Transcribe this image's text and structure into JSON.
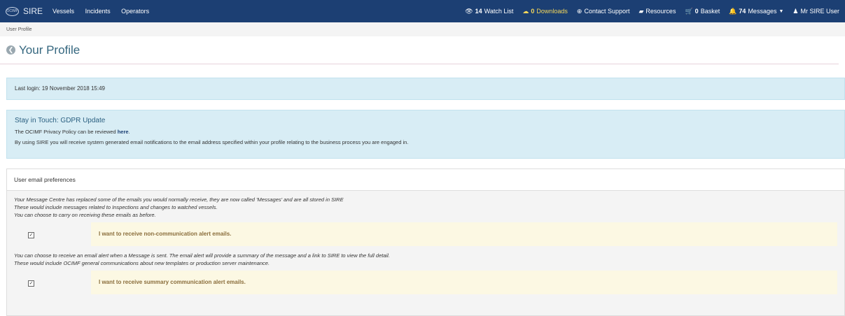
{
  "nav": {
    "brand": "SIRE",
    "logo_text": "OCIMF",
    "left": [
      "Vessels",
      "Incidents",
      "Operators"
    ],
    "watch": {
      "count": "14",
      "label": "Watch List"
    },
    "downloads": {
      "count": "0",
      "label": "Downloads"
    },
    "support": "Contact Support",
    "resources": "Resources",
    "basket": {
      "count": "0",
      "label": "Basket"
    },
    "messages": {
      "count": "74",
      "label": "Messages"
    },
    "user": "Mr SIRE User"
  },
  "breadcrumb": "User Profile",
  "page_title": "Your Profile",
  "last_login": "Last login: 19 November 2018 15:49",
  "gdpr": {
    "heading": "Stay in Touch: GDPR Update",
    "line1_prefix": "The OCIMF Privacy Policy can be reviewed ",
    "line1_link": "here",
    "line1_suffix": ".",
    "line2": "By using SIRE you will receive system generated email notifications to the email address specified within your profile relating to the business process you are engaged in."
  },
  "prefs": {
    "heading": "User email preferences",
    "intro": [
      "Your Message Centre has replaced some of the emails you would normally receive, they are now called 'Messages' and are all stored in SIRE",
      "These would include messages related to Inspections and changes to watched vessels.",
      "You can choose to carry on receiving these emails as before."
    ],
    "option1": "I want to receive non-communication alert emails.",
    "intro2": [
      "You can choose to receive an email alert when a Message is sent. The email alert will provide a summary of the message and a link to SIRE to view the full detail.",
      "These would include OCIMF general communications about new templates or production server maintenance."
    ],
    "option2": "I want to receive summary communication alert emails."
  }
}
